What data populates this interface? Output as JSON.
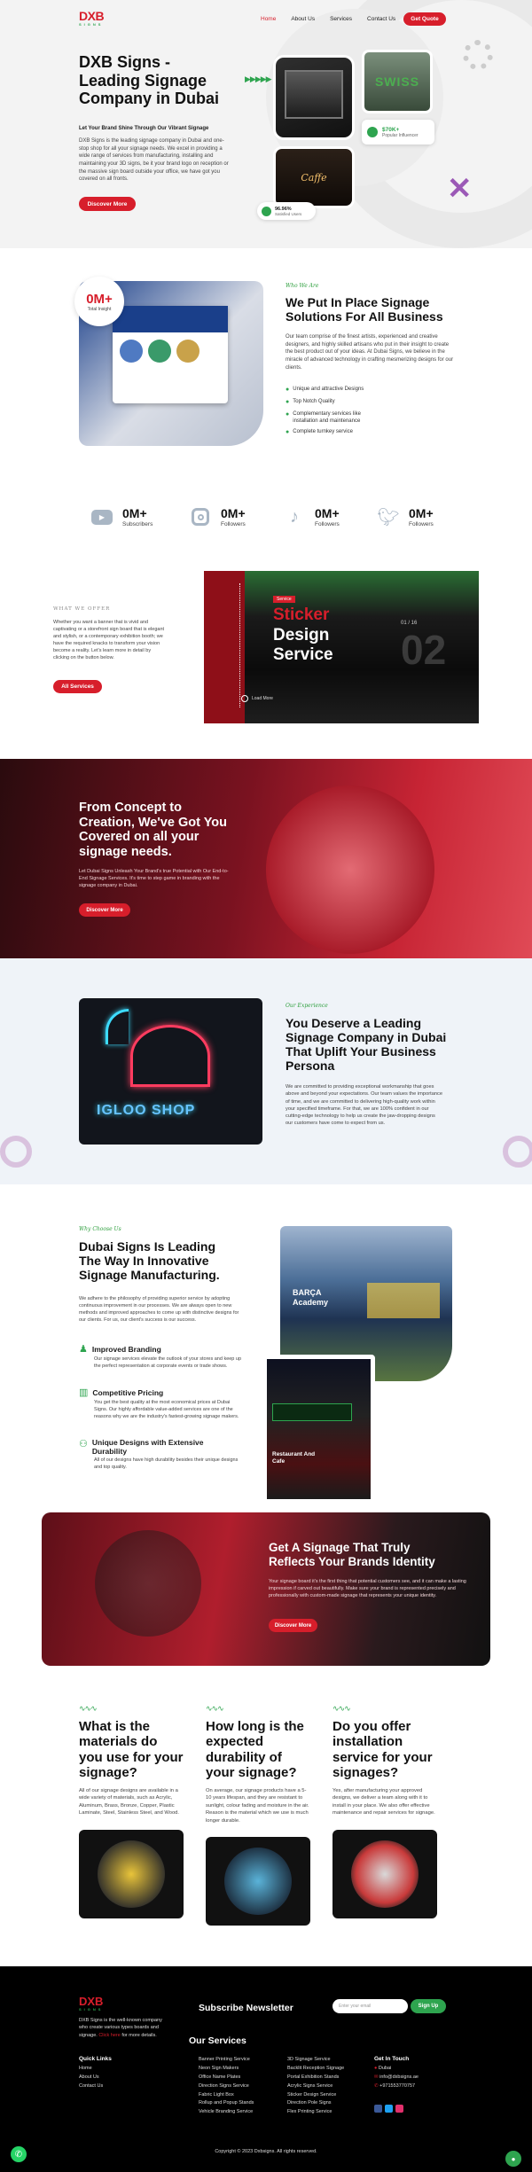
{
  "header": {
    "logo_text": "DXB",
    "logo_sub": "SIGNS",
    "nav": [
      "Home",
      "About Us",
      "Services",
      "Contact Us"
    ],
    "cta": "Get Quote"
  },
  "hero": {
    "title": "DXB Signs - Leading Signage Company in Dubai",
    "subtitle": "Let Your Brand Shine Through Our Vibrant Signage",
    "desc": "DXB Signs is the leading signage company in Dubai and one-stop shop for all your signage needs. We excel in providing a wide range of services from manufacturing, installing and maintaining your 3D signs, be it your brand logo on reception or the massive sign board outside your office, we have got you covered on all fronts.",
    "button": "Discover More",
    "stat_influencer_value": "$70K+",
    "stat_influencer_label": "Popular Influencer",
    "stat_satisfied_value": "96.96%",
    "stat_satisfied_label": "Satisfied Users",
    "img_text_1": "SWISS",
    "img_text_2": "Caffe"
  },
  "who": {
    "tag": "Who We Are",
    "badge_value": "0M+",
    "badge_label": "Total Insight",
    "title": "We Put In Place Signage Solutions For All Business",
    "desc": "Our team comprise of the finest artists, experienced and creative designers, and highly skilled artisans who put in their insight to create the best product out of your ideas. At Dubai Signs, we believe in the miracle of advanced technology in crafting mesmerizing designs for our clients.",
    "features": [
      "Unique and attractive Designs",
      "Top Notch Quality",
      "Complementary services like installation and maintenance",
      "Complete turnkey service"
    ]
  },
  "social": [
    {
      "icon": "youtube-icon",
      "value": "0M+",
      "label": "Subscribers"
    },
    {
      "icon": "instagram-icon",
      "value": "0M+",
      "label": "Followers"
    },
    {
      "icon": "tiktok-icon",
      "value": "0M+",
      "label": "Followers"
    },
    {
      "icon": "twitter-icon",
      "value": "0M+",
      "label": "Followers"
    }
  ],
  "offer": {
    "tag": "WHAT WE OFFER",
    "desc": "Whether you want a banner that is vivid and captivating or a storefront sign board that is elegant and stylish, or a contemporary exhibition booth; we have the required knacks to transform your vision become a reality. Let's learn more in detail by clicking on the button below.",
    "button": "All Services",
    "slider_label": "Service",
    "slider_title_1": "Sticker",
    "slider_title_2": "Design Service",
    "slider_counter": "01 / 16",
    "slider_big_num": "02",
    "slider_more": "Load More"
  },
  "concept": {
    "title": "From Concept to Creation, We've Got You Covered on all your signage needs.",
    "desc": "Let Dubai Signs Unleash Your Brand's true Potential with Our End-to-End Signage Services. It's time to step game in branding with the signage company in Dubai.",
    "button": "Discover More"
  },
  "experience": {
    "tag": "Our Experience",
    "title": "You Deserve a Leading Signage Company in Dubai That Uplift Your Business Persona",
    "desc": "We are committed to providing exceptional workmanship that goes above and beyond your expectations. Our team values the importance of time, and we are committed to delivering high-quality work within your specified timeframe. For that, we are 100% confident in our cutting-edge technology to help us create the jaw-dropping designs our customers have come to expect from us.",
    "img_text": "IGLOO SHOP"
  },
  "why": {
    "tag": "Why Choose Us",
    "title": "Dubai Signs Is Leading The Way In Innovative Signage Manufacturing.",
    "desc": "We adhere to the philosophy of providing superior service by adopting continuous improvement in our processes. We are always open to new methods and improved approaches to come up with distinctive designs for our clients. For us, our client's success is our success.",
    "items": [
      {
        "icon": "brand-icon",
        "title": "Improved Branding",
        "text": "Our signage services elevate the outlook of your stores and keep up the perfect representation at corporate events or trade shows."
      },
      {
        "icon": "chart-icon",
        "title": "Competitive Pricing",
        "text": "You get the best quality at the most economical prices at Dubai Signs. Our highly affordable value-added services are one of the reasons why we are the industry's fastest-growing signage makers."
      },
      {
        "icon": "people-icon",
        "title": "Unique Designs with Extensive Durability",
        "text": "All of our designs have high durability besides their unique designs and top quality."
      }
    ],
    "img_text_1": "BARÇA Academy",
    "img_text_2": "Restaurant And Cafe"
  },
  "identity": {
    "title": "Get A Signage That Truly Reflects Your Brands Identity",
    "desc": "Your signage board it's the first thing that potential customers see, and it can make a lasting impression if carved out beautifully. Make sure your brand is represented precisely and professionally with custom-made signage that represents your unique identity.",
    "button": "Discover More"
  },
  "faq": [
    {
      "title": "What is the materials do you use for your signage?",
      "text": "All of our signage designs are available in a wide variety of materials, such as Acrylic, Aluminum, Brass, Bronze, Copper, Plastic Laminate, Steel, Stainless Steel, and Wood."
    },
    {
      "title": "How long is the expected durability of your signage?",
      "text": "On average, our signage products have a 5-10 years lifespan, and they are resistant to sunlight, colour fading and moisture in the air. Reason is the material which we use is much longer durable."
    },
    {
      "title": "Do you offer installation service for your signages?",
      "text": "Yes, after manufacturing your approved designs, we deliver a team along with it to install in your place. We also offer effective maintenance and repair services for signage."
    }
  ],
  "footer": {
    "about": "DXB Signs is the well-known company who create various types boards and signage.",
    "about_link": "Click here",
    "about_tail": "for more details.",
    "newsletter_title": "Subscribe Newsletter",
    "newsletter_placeholder": "Enter your email",
    "newsletter_button": "Sign Up",
    "quick_links_title": "Quick Links",
    "quick_links": [
      "Home",
      "About Us",
      "Contact Us"
    ],
    "services_title": "Our Services",
    "services_col1": [
      "Banner Printing Service",
      "Neon Sign Makers",
      "Office Name Plates",
      "Direction Signs Service",
      "Fabric Light Box",
      "Rollup and Popup Stands",
      "Vehicle Branding Service"
    ],
    "services_col2": [
      "3D Signage Service",
      "Backlit Reception Signage",
      "Portal Exhibition Stands",
      "Acrylic Signs Service",
      "Sticker Design Service",
      "Direction Pole Signs",
      "Flex Printing Service"
    ],
    "contact_title": "Get In Touch",
    "contact": [
      "Dubai",
      "info@dxbsigns.ae",
      "+971553770757"
    ],
    "copyright": "Copyright © 2023 Dxbsigns. All rights reserved."
  }
}
